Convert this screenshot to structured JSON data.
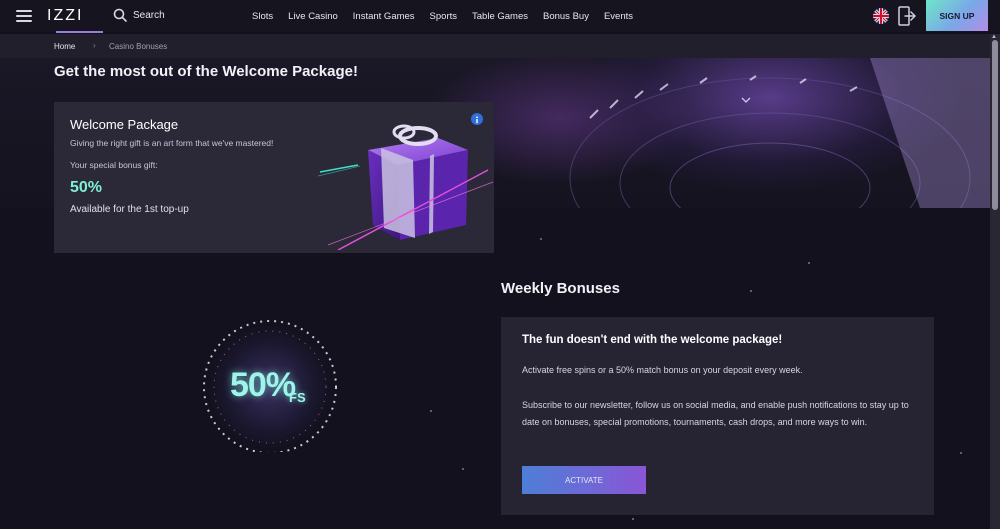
{
  "header": {
    "logo": "IZZI",
    "search_label": "Search",
    "nav": [
      "Slots",
      "Live Casino",
      "Instant Games",
      "Sports",
      "Table Games",
      "Bonus Buy",
      "Events"
    ],
    "signup_label": "SIGN UP"
  },
  "breadcrumb": {
    "home": "Home",
    "separator": "›",
    "current": "Casino Bonuses"
  },
  "welcome": {
    "page_title": "Get the most out of the Welcome Package!",
    "card_title": "Welcome Package",
    "description": "Giving the right gift is an art form that we've mastered!",
    "subtitle": "Your special bonus gift:",
    "percent": "50%",
    "available": "Available for the 1st top-up"
  },
  "weekly": {
    "title": "Weekly Bonuses",
    "heading": "The fun doesn't end with the welcome package!",
    "paragraph1": "Activate free spins or a 50% match bonus on your deposit every week.",
    "paragraph2": "Subscribe to our newsletter, follow us on social media, and enable push notifications to stay up to date on bonuses, special promotions, tournaments, cash drops, and more ways to win.",
    "activate_label": "ACTIVATE",
    "badge_percent": "50%",
    "badge_suffix": "FS"
  },
  "colors": {
    "background": "#13111d",
    "card": "#2b2838",
    "accent_teal": "#7ff0d4",
    "accent_purple": "#8a55d6",
    "accent_blue": "#4d7fd6"
  },
  "icons": [
    "hamburger-icon",
    "search-icon",
    "uk-flag-icon",
    "login-icon",
    "info-icon",
    "chevron-down-icon",
    "gift-illustration",
    "fs-badge-illustration"
  ]
}
